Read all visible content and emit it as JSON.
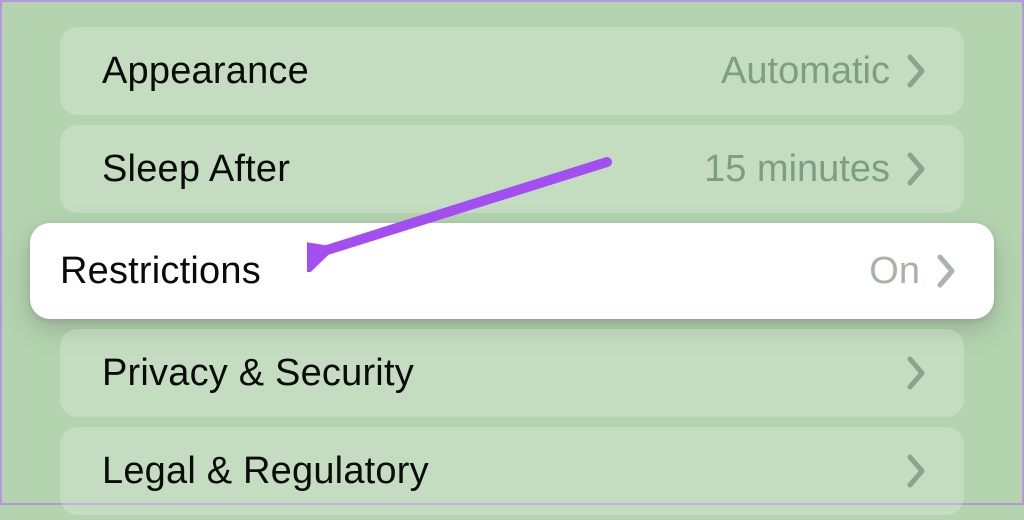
{
  "settings": {
    "rows": [
      {
        "label": "Appearance",
        "value": "Automatic",
        "highlight": false
      },
      {
        "label": "Sleep After",
        "value": "15 minutes",
        "highlight": false
      },
      {
        "label": "Restrictions",
        "value": "On",
        "highlight": true
      },
      {
        "label": "Privacy & Security",
        "value": "",
        "highlight": false
      },
      {
        "label": "Legal & Regulatory",
        "value": "",
        "highlight": false
      }
    ]
  },
  "annotation": {
    "color": "#a24ef0"
  }
}
